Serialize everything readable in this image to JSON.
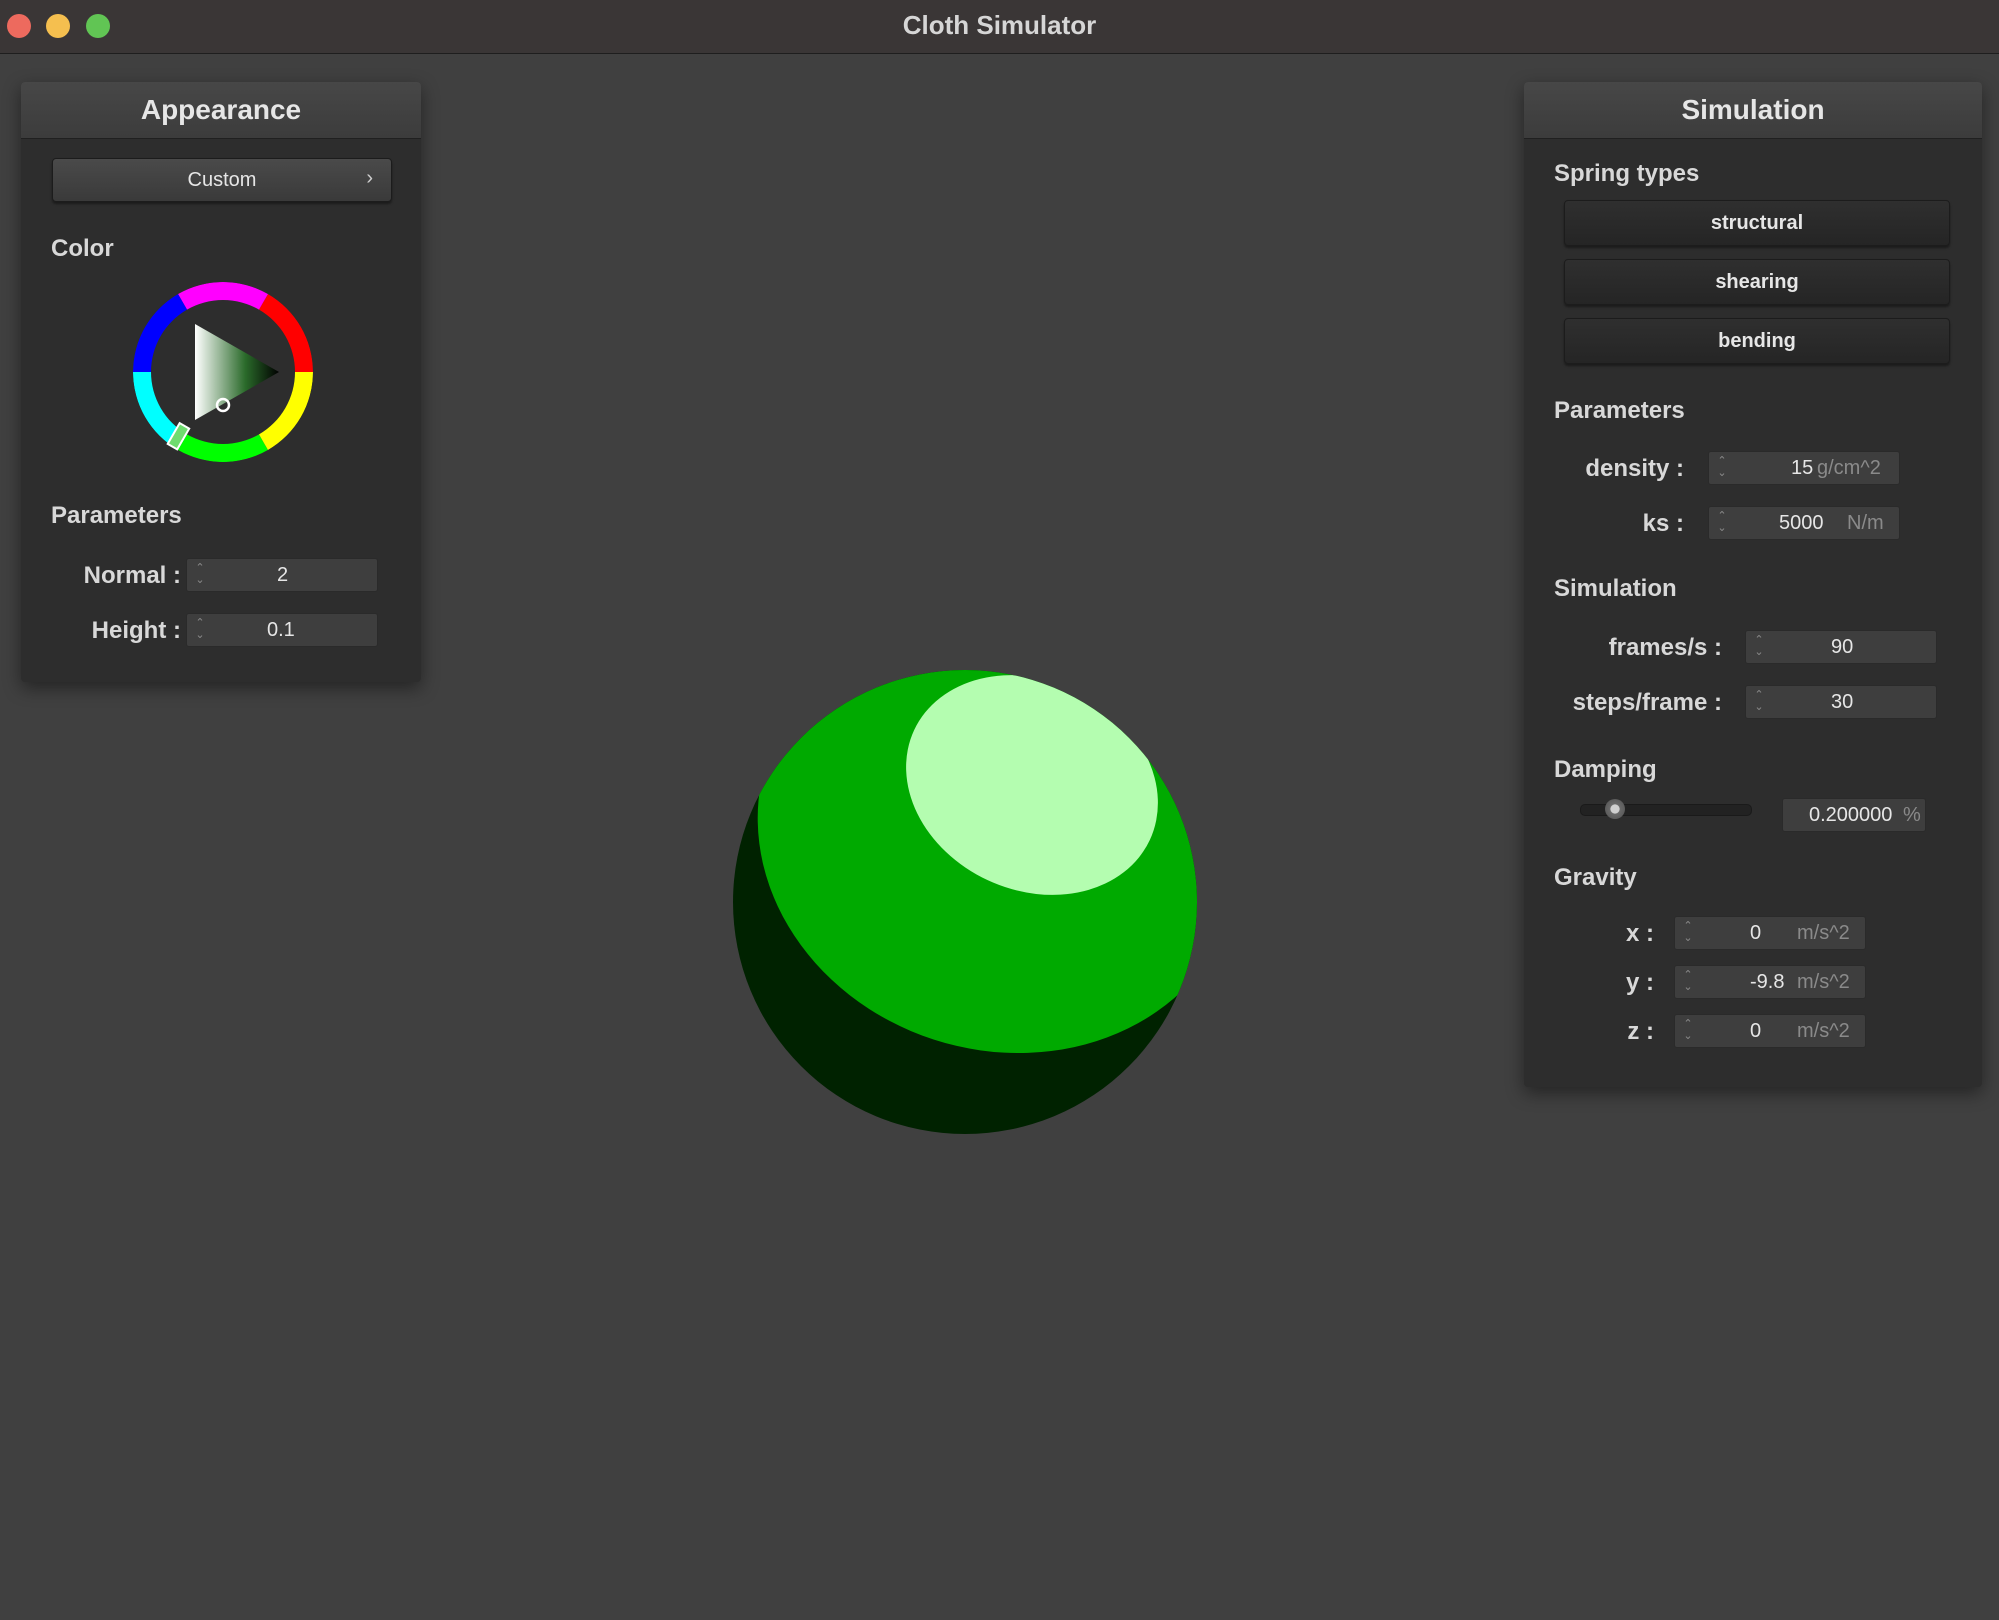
{
  "window": {
    "title": "Cloth Simulator"
  },
  "appearance": {
    "title": "Appearance",
    "preset": "Custom",
    "color_label": "Color",
    "color": "#00ff00",
    "params_label": "Parameters",
    "normal": {
      "label": "Normal :",
      "value": "2"
    },
    "height": {
      "label": "Height :",
      "value": "0.1"
    }
  },
  "simulation": {
    "title": "Simulation",
    "spring_types_label": "Spring types",
    "spring_types": [
      "structural",
      "shearing",
      "bending"
    ],
    "params_label": "Parameters",
    "density": {
      "label": "density :",
      "value": "15",
      "unit": "g/cm^2"
    },
    "ks": {
      "label": "ks :",
      "value": "5000",
      "unit": "N/m"
    },
    "sim_label": "Simulation",
    "fps": {
      "label": "frames/s :",
      "value": "90"
    },
    "steps": {
      "label": "steps/frame :",
      "value": "30"
    },
    "damping_label": "Damping",
    "damping": {
      "value": "0.200000",
      "unit": "%",
      "slider_fraction": 0.2
    },
    "gravity_label": "Gravity",
    "gx": {
      "label": "x :",
      "value": "0",
      "unit": "m/s^2"
    },
    "gy": {
      "label": "y :",
      "value": "-9.8",
      "unit": "m/s^2"
    },
    "gz": {
      "label": "z :",
      "value": "0",
      "unit": "m/s^2"
    }
  },
  "scene": {
    "sphere_colors": {
      "base": "#00aa00",
      "shadow": "#002200",
      "highlight": "#b4fdb0"
    }
  }
}
